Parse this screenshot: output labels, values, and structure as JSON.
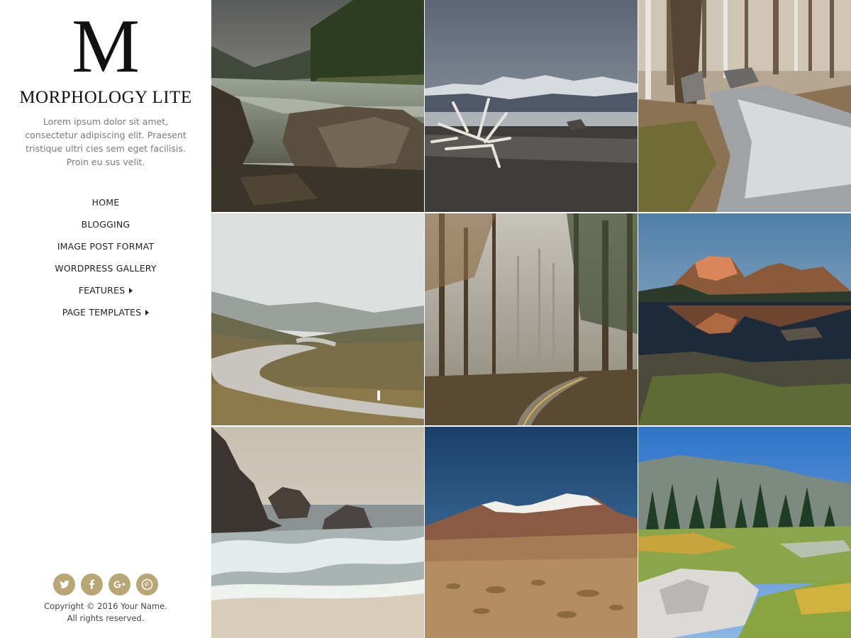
{
  "site": {
    "logo_letter": "M",
    "title": "MORPHOLOGY LITE",
    "tagline": "Lorem ipsum dolor sit amet, consectetur adipiscing elit. Praesent tristique ultri cies sem eget facilisis. Proin eu sus velit."
  },
  "nav": {
    "items": [
      {
        "label": "HOME",
        "has_submenu": false
      },
      {
        "label": "BLOGGING",
        "has_submenu": false
      },
      {
        "label": "IMAGE POST FORMAT",
        "has_submenu": false
      },
      {
        "label": "WORDPRESS GALLERY",
        "has_submenu": false
      },
      {
        "label": "FEATURES",
        "has_submenu": true
      },
      {
        "label": "PAGE TEMPLATES",
        "has_submenu": true
      }
    ]
  },
  "social": {
    "accent_color": "#b9a675",
    "icons": [
      "twitter-icon",
      "facebook-icon",
      "google-plus-icon",
      "pinterest-icon"
    ]
  },
  "footer": {
    "copyright_line1": "Copyright © 2016 Your Name.",
    "copyright_line2": "All rights reserved."
  },
  "gallery": {
    "tiles": [
      {
        "subject": "river with rocks and forest"
      },
      {
        "subject": "driftwood on lakeshore with snowy mountains"
      },
      {
        "subject": "forest stream with birch trees"
      },
      {
        "subject": "winding road through hills"
      },
      {
        "subject": "foggy forest road"
      },
      {
        "subject": "mountain reflection in lake"
      },
      {
        "subject": "sea stacks with waves"
      },
      {
        "subject": "volcano over desert"
      },
      {
        "subject": "meadow with pine forest and granite"
      }
    ]
  }
}
